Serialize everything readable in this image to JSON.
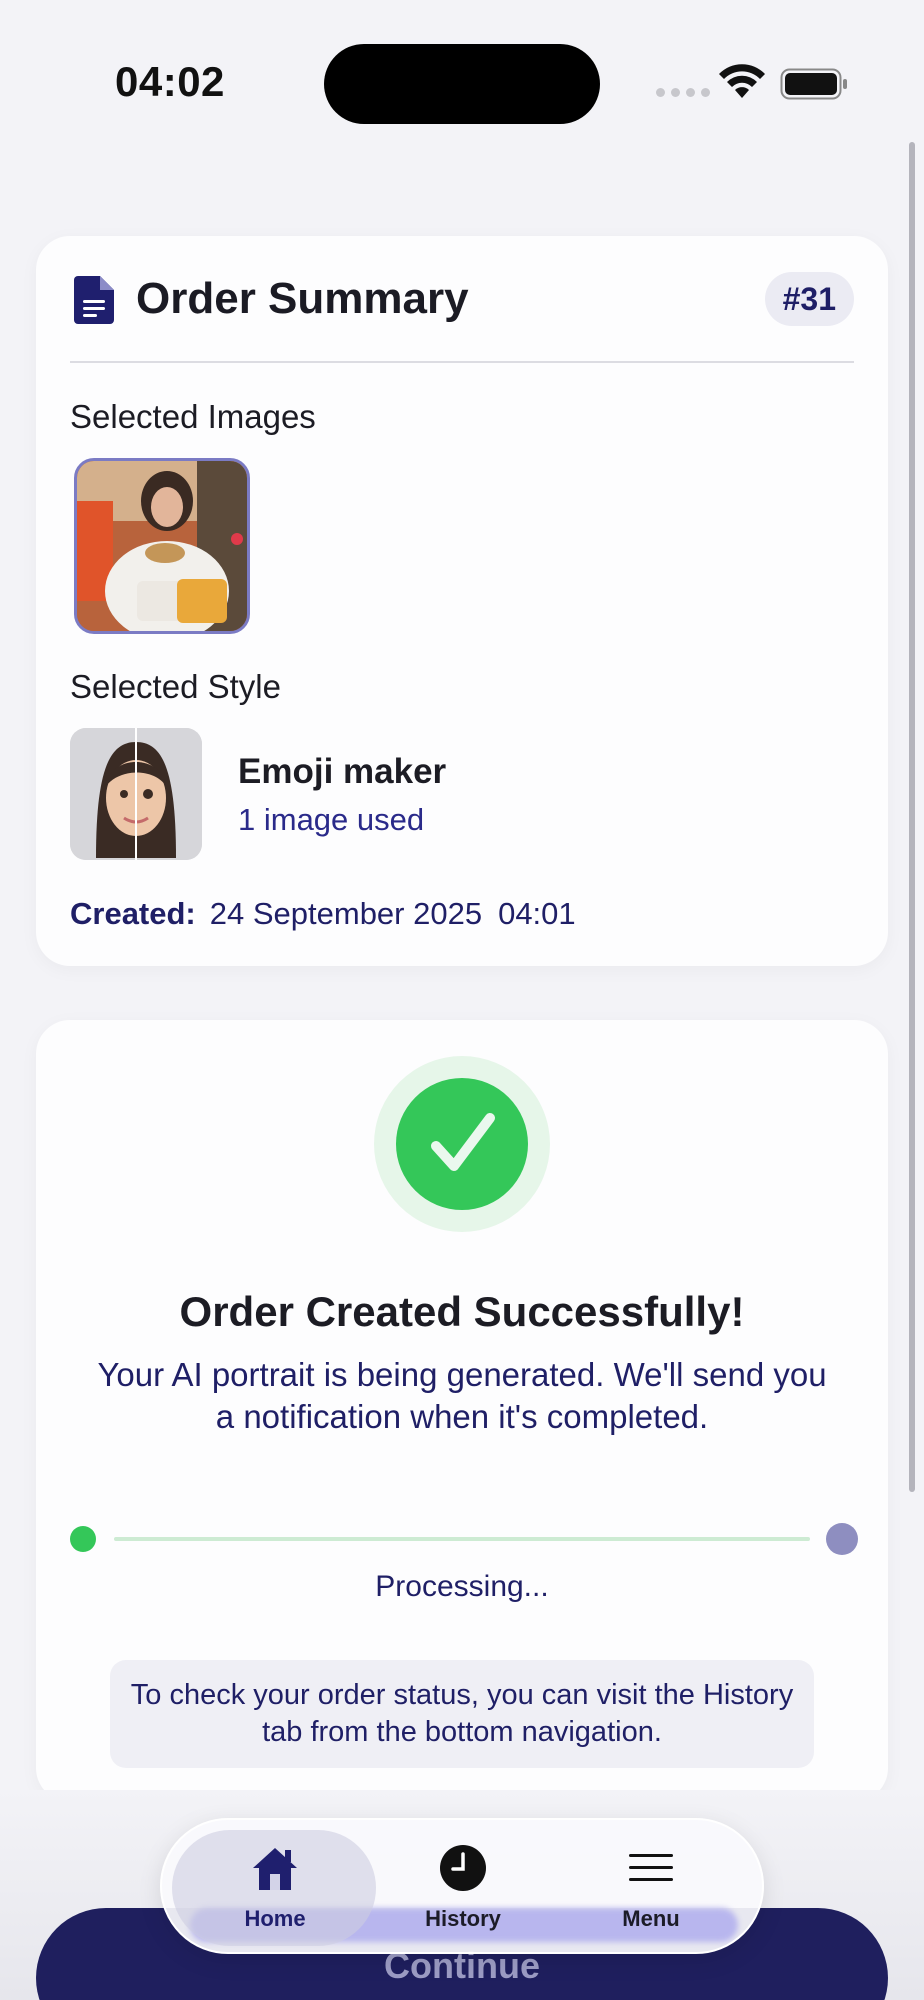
{
  "status_bar": {
    "time": "04:02"
  },
  "summary": {
    "title": "Order Summary",
    "order_number": "#31",
    "selected_images_label": "Selected Images",
    "selected_style_label": "Selected Style",
    "style_name": "Emoji maker",
    "style_usage": "1 image used",
    "created_label": "Created:",
    "created_date": "24 September 2025",
    "created_time": "04:01"
  },
  "success": {
    "title": "Order Created Successfully!",
    "message": "Your AI portrait is being generated. We'll send you a notification when it's completed.",
    "progress_status": "Processing...",
    "info": "To check your order status, you can visit the History tab from the bottom navigation."
  },
  "continue_button": "Continue",
  "tabbar": {
    "items": [
      {
        "label": "Home",
        "icon": "home-icon",
        "selected": true
      },
      {
        "label": "History",
        "icon": "clock-icon",
        "selected": false
      },
      {
        "label": "Menu",
        "icon": "menu-icon",
        "selected": false
      }
    ]
  },
  "colors": {
    "accent": "#1f1f5e",
    "success": "#34c759",
    "background": "#f3f3f7"
  }
}
